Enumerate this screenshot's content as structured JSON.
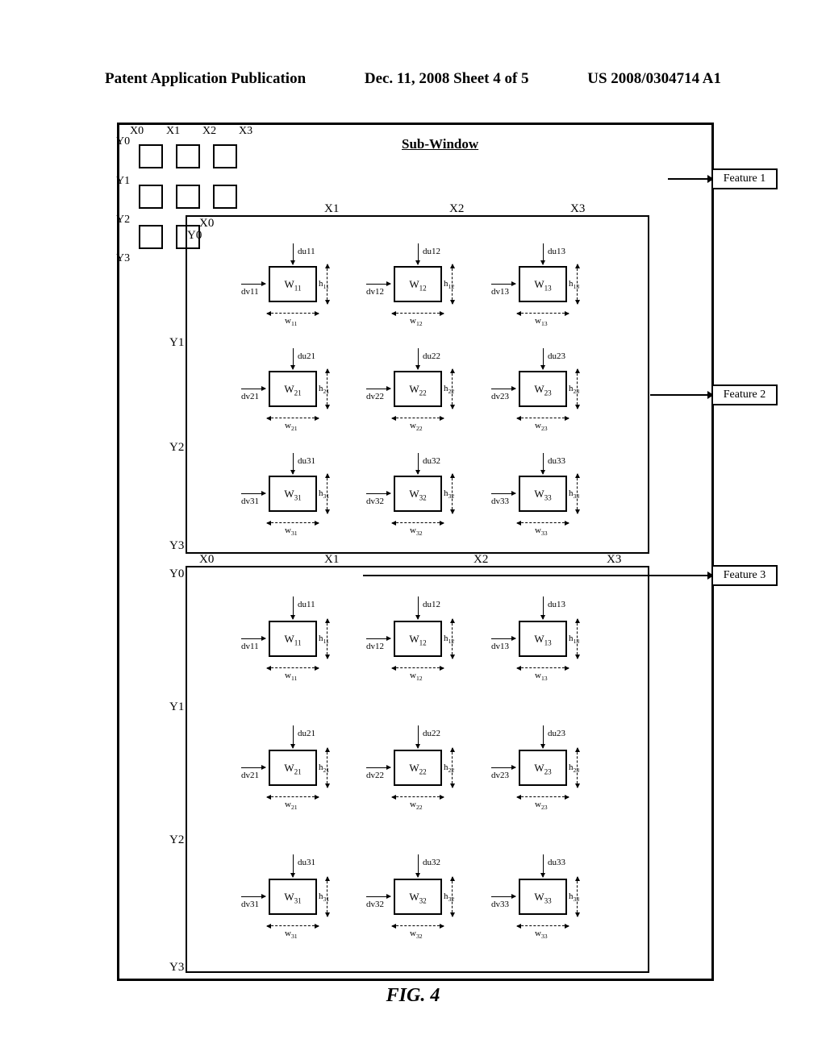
{
  "header": {
    "left": "Patent Application Publication",
    "center": "Dec. 11, 2008  Sheet 4 of 5",
    "right": "US 2008/0304714 A1"
  },
  "title": "Sub-Window",
  "features": {
    "f1": "Feature 1",
    "f2": "Feature 2",
    "f3": "Feature 3"
  },
  "axes": {
    "x": [
      "X0",
      "X1",
      "X2",
      "X3"
    ],
    "y": [
      "Y0",
      "Y1",
      "Y2",
      "Y3"
    ]
  },
  "cells": {
    "r1c1": "W11",
    "r1c2": "W12",
    "r1c3": "W13",
    "r2c1": "W21",
    "r2c2": "W22",
    "r2c3": "W23",
    "r3c1": "W31",
    "r3c2": "W32",
    "r3c3": "W33"
  },
  "du": {
    "r1c1": "du11",
    "r1c2": "du12",
    "r1c3": "du13",
    "r2c1": "du21",
    "r2c2": "du22",
    "r2c3": "du23",
    "r3c1": "du31",
    "r3c2": "du32",
    "r3c3": "du33"
  },
  "dv": {
    "r1c1": "dv11",
    "r1c2": "dv12",
    "r1c3": "dv13",
    "r2c1": "dv21",
    "r2c2": "dv22",
    "r2c3": "dv23",
    "r3c1": "dv31",
    "r3c2": "dv32",
    "r3c3": "dv33"
  },
  "h": {
    "r1c1": "h11",
    "r1c2": "h12",
    "r1c3": "h13",
    "r2c1": "h21",
    "r2c2": "h22",
    "r2c3": "h23",
    "r3c1": "h31",
    "r3c2": "h32",
    "r3c3": "h33"
  },
  "w": {
    "r1c1": "w11",
    "r1c2": "w12",
    "r1c3": "w13",
    "r2c1": "w21",
    "r2c2": "w22",
    "r2c3": "w23",
    "r3c1": "w31",
    "r3c2": "w32",
    "r3c3": "w33"
  },
  "fig": "FIG. 4"
}
